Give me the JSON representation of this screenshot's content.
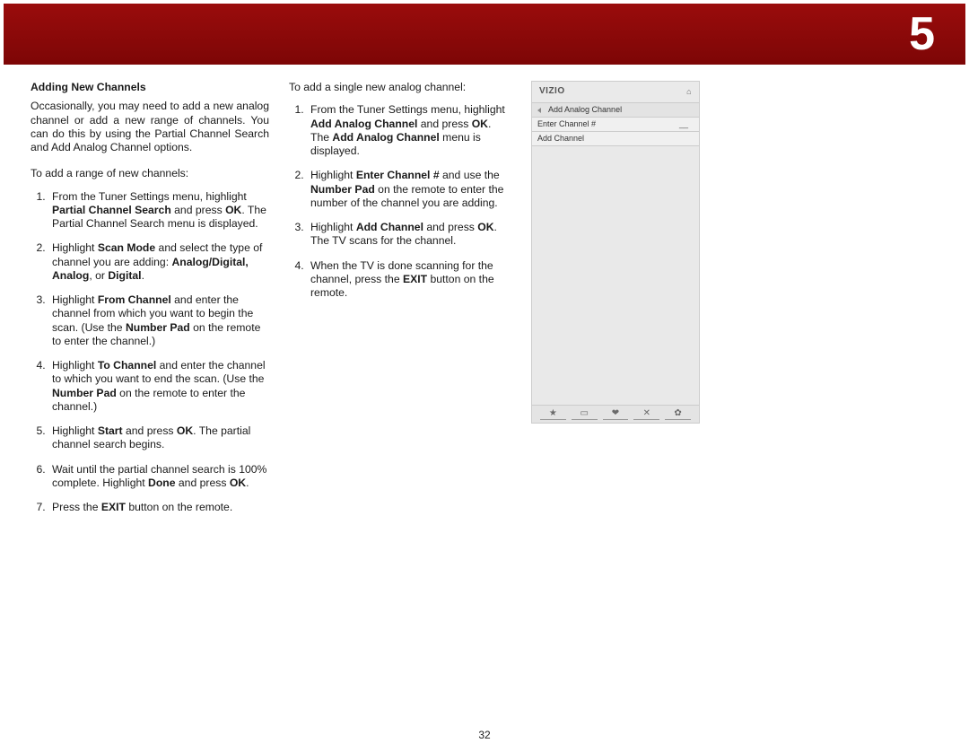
{
  "chapter_number": "5",
  "page_number": "32",
  "section": {
    "title": "Adding New Channels",
    "intro": "Occasionally, you may need to add a new analog channel or add a new range of channels. You can do this by using the Partial Channel Search and Add Analog Channel options.",
    "range_lead": "To add a range of new channels:",
    "range_steps": {
      "s1_a": "From the Tuner Settings menu, highlight ",
      "s1_b": "Partial Channel Search",
      "s1_c": " and press ",
      "s1_d": "OK",
      "s1_e": ". The Partial Channel Search menu is displayed.",
      "s2_a": "Highlight ",
      "s2_b": "Scan Mode",
      "s2_c": " and select the type of channel you are adding: ",
      "s2_d": "Analog/Digital, Analog",
      "s2_e": ", or ",
      "s2_f": "Digital",
      "s2_g": ".",
      "s3_a": "Highlight ",
      "s3_b": "From Channel",
      "s3_c": " and enter the channel from which you want to begin the scan. (Use the ",
      "s3_d": "Number Pad",
      "s3_e": " on the remote to enter the channel.)",
      "s4_a": "Highlight ",
      "s4_b": "To Channel",
      "s4_c": " and enter the channel to which you want to end the scan. (Use the ",
      "s4_d": "Number Pad",
      "s4_e": " on the remote to enter the channel.)",
      "s5_a": "Highlight ",
      "s5_b": "Start",
      "s5_c": " and press ",
      "s5_d": "OK",
      "s5_e": ". The partial channel search begins.",
      "s6_a": "Wait until the partial channel search is 100% complete. Highlight ",
      "s6_b": "Done",
      "s6_c": " and press ",
      "s6_d": "OK",
      "s6_e": ".",
      "s7_a": "Press the ",
      "s7_b": "EXIT",
      "s7_c": " button on the remote."
    },
    "single_lead": "To add a single new analog channel:",
    "single_steps": {
      "s1_a": "From the Tuner Settings menu, highlight ",
      "s1_b": "Add Analog Channel",
      "s1_c": " and press ",
      "s1_d": "OK",
      "s1_e": ". The ",
      "s1_f": "Add Analog Channel",
      "s1_g": " menu is displayed.",
      "s2_a": "Highlight ",
      "s2_b": "Enter Channel #",
      "s2_c": " and use the ",
      "s2_d": "Number Pad",
      "s2_e": " on the remote to enter the number of the channel you are adding.",
      "s3_a": "Highlight ",
      "s3_b": "Add Channel",
      "s3_c": " and press ",
      "s3_d": "OK",
      "s3_e": ". The TV scans for the channel.",
      "s4_a": "When the TV is done scanning for the channel, press the ",
      "s4_b": "EXIT",
      "s4_c": " button on the remote."
    }
  },
  "menu": {
    "brand": "VIZIO",
    "home_icon": "⌂",
    "title_row": "Add Analog Channel",
    "row2_label": "Enter Channel #",
    "row2_value": "__",
    "row3_label": "Add Channel",
    "footer": {
      "star": "★",
      "rect": "▭",
      "v": "❤",
      "x": "✕",
      "gear": "✿"
    }
  }
}
